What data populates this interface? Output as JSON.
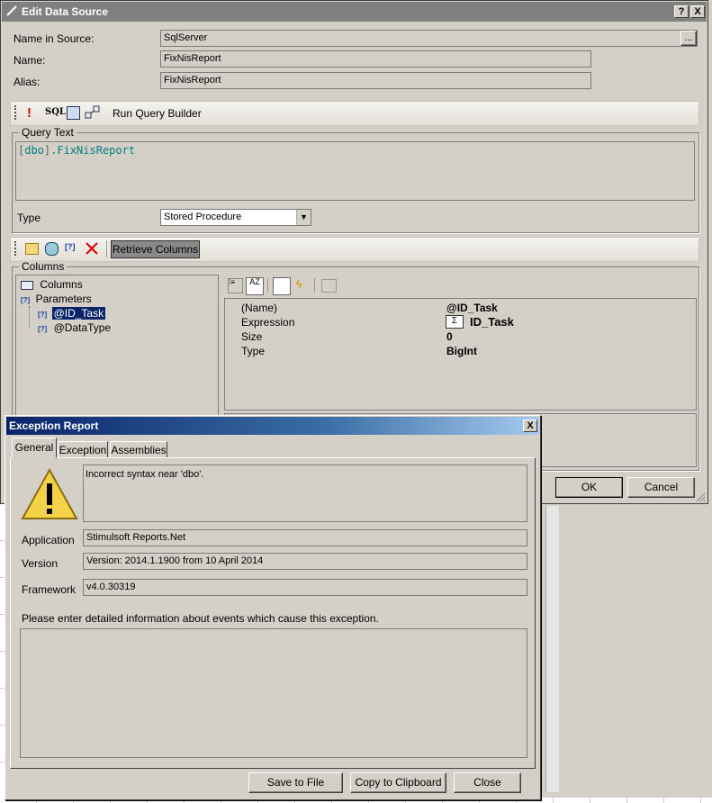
{
  "edit_dialog": {
    "title": "Edit Data Source",
    "help_btn": "?",
    "close_btn": "X",
    "name_in_source_label": "Name in Source:",
    "name_in_source_value": "SqlServer",
    "browse_btn": "...",
    "name_label": "Name:",
    "name_value": "FixNisReport",
    "alias_label": "Alias:",
    "alias_value": "FixNisReport",
    "toolbar": {
      "sql_label": "SQL",
      "run_query_builder": "Run Query Builder"
    },
    "query_group_label": "Query Text",
    "query_text": {
      "bracket_open": "[",
      "schema": "dbo",
      "bracket_close": "]",
      "rest": ".FixNisReport"
    },
    "type_label": "Type",
    "type_value": "Stored Procedure",
    "retrieve_columns": "Retrieve Columns",
    "columns_group_label": "Columns",
    "tree": {
      "columns": "Columns",
      "parameters": "Parameters",
      "param1": "@ID_Task",
      "param2": "@DataType"
    },
    "properties": [
      {
        "name": "(Name)",
        "value": "@ID_Task"
      },
      {
        "name": "Expression",
        "value": "ID_Task"
      },
      {
        "name": "Size",
        "value": "0"
      },
      {
        "name": "Type",
        "value": "BigInt"
      }
    ],
    "ok": "OK",
    "cancel": "Cancel"
  },
  "exception_dialog": {
    "title": "Exception Report",
    "close_btn": "X",
    "tabs": [
      "General",
      "Exception",
      "Assemblies"
    ],
    "message": "Incorrect syntax near 'dbo'.",
    "application_label": "Application",
    "application_value": "Stimulsoft Reports.Net",
    "version_label": "Version",
    "version_value": "Version: 2014.1.1900 from 10 April 2014",
    "framework_label": "Framework",
    "framework_value": "v4.0.30319",
    "instructions": "Please enter detailed information about events which cause this exception.",
    "save_to_file": "Save to File",
    "copy_to_clipboard": "Copy to Clipboard",
    "close": "Close"
  }
}
